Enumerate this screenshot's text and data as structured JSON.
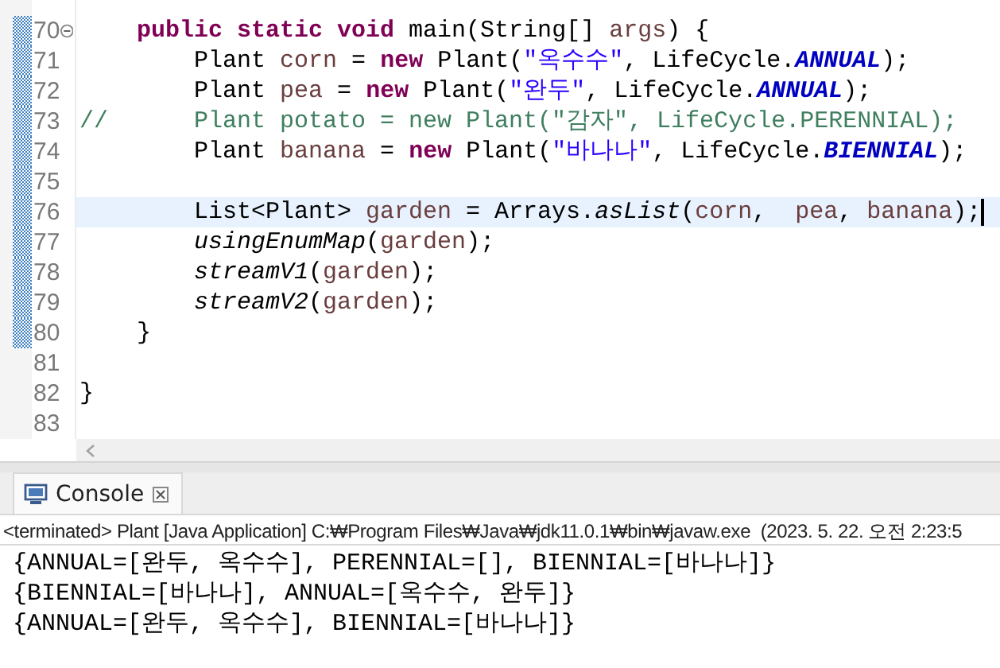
{
  "editor": {
    "lines": [
      {
        "number": "70",
        "marked": true,
        "fold_toggle": true,
        "current": false,
        "tokens": [
          {
            "kind": "keyword",
            "text": "    public"
          },
          {
            "kind": "keyword",
            "text": " static"
          },
          {
            "kind": "keyword",
            "text": " void"
          },
          {
            "kind": "plain",
            "text": " main(String[] "
          },
          {
            "kind": "local",
            "text": "args"
          },
          {
            "kind": "plain",
            "text": ") {"
          }
        ]
      },
      {
        "number": "71",
        "marked": true,
        "fold_toggle": false,
        "current": false,
        "tokens": [
          {
            "kind": "plain",
            "text": "        Plant "
          },
          {
            "kind": "local",
            "text": "corn"
          },
          {
            "kind": "plain",
            "text": " = "
          },
          {
            "kind": "keyword",
            "text": "new"
          },
          {
            "kind": "plain",
            "text": " Plant("
          },
          {
            "kind": "string",
            "text": "\"옥수수\""
          },
          {
            "kind": "plain",
            "text": ", LifeCycle."
          },
          {
            "kind": "field",
            "text": "ANNUAL"
          },
          {
            "kind": "plain",
            "text": ");"
          }
        ]
      },
      {
        "number": "72",
        "marked": true,
        "fold_toggle": false,
        "current": false,
        "tokens": [
          {
            "kind": "plain",
            "text": "        Plant "
          },
          {
            "kind": "local",
            "text": "pea"
          },
          {
            "kind": "plain",
            "text": " = "
          },
          {
            "kind": "keyword",
            "text": "new"
          },
          {
            "kind": "plain",
            "text": " Plant("
          },
          {
            "kind": "string",
            "text": "\"완두\""
          },
          {
            "kind": "plain",
            "text": ", LifeCycle."
          },
          {
            "kind": "field",
            "text": "ANNUAL"
          },
          {
            "kind": "plain",
            "text": ");"
          }
        ]
      },
      {
        "number": "73",
        "marked": true,
        "fold_toggle": false,
        "current": false,
        "tokens": [
          {
            "kind": "comment",
            "text": "//      Plant potato = new Plant(\"감자\", LifeCycle.PERENNIAL);"
          }
        ]
      },
      {
        "number": "74",
        "marked": true,
        "fold_toggle": false,
        "current": false,
        "tokens": [
          {
            "kind": "plain",
            "text": "        Plant "
          },
          {
            "kind": "local",
            "text": "banana"
          },
          {
            "kind": "plain",
            "text": " = "
          },
          {
            "kind": "keyword",
            "text": "new"
          },
          {
            "kind": "plain",
            "text": " Plant("
          },
          {
            "kind": "string",
            "text": "\"바나나\""
          },
          {
            "kind": "plain",
            "text": ", LifeCycle."
          },
          {
            "kind": "field",
            "text": "BIENNIAL"
          },
          {
            "kind": "plain",
            "text": ");"
          }
        ]
      },
      {
        "number": "75",
        "marked": true,
        "fold_toggle": false,
        "current": false
      },
      {
        "number": "76",
        "marked": true,
        "fold_toggle": false,
        "current": true,
        "tokens": [
          {
            "kind": "plain",
            "text": "        List<Plant> "
          },
          {
            "kind": "local",
            "text": "garden"
          },
          {
            "kind": "plain",
            "text": " = Arrays."
          },
          {
            "kind": "method",
            "text": "asList"
          },
          {
            "kind": "plain",
            "text": "("
          },
          {
            "kind": "local",
            "text": "corn"
          },
          {
            "kind": "plain",
            "text": ",  "
          },
          {
            "kind": "local",
            "text": "pea"
          },
          {
            "kind": "plain",
            "text": ", "
          },
          {
            "kind": "local",
            "text": "banana"
          },
          {
            "kind": "plain",
            "text": ");"
          }
        ]
      },
      {
        "number": "77",
        "marked": true,
        "fold_toggle": false,
        "current": false,
        "tokens": [
          {
            "kind": "method",
            "text": "        usingEnumMap"
          },
          {
            "kind": "plain",
            "text": "("
          },
          {
            "kind": "local",
            "text": "garden"
          },
          {
            "kind": "plain",
            "text": ");"
          }
        ]
      },
      {
        "number": "78",
        "marked": true,
        "fold_toggle": false,
        "current": false,
        "tokens": [
          {
            "kind": "method",
            "text": "        streamV1"
          },
          {
            "kind": "plain",
            "text": "("
          },
          {
            "kind": "local",
            "text": "garden"
          },
          {
            "kind": "plain",
            "text": ");"
          }
        ]
      },
      {
        "number": "79",
        "marked": true,
        "fold_toggle": false,
        "current": false,
        "tokens": [
          {
            "kind": "method",
            "text": "        streamV2"
          },
          {
            "kind": "plain",
            "text": "("
          },
          {
            "kind": "local",
            "text": "garden"
          },
          {
            "kind": "plain",
            "text": ");"
          }
        ]
      },
      {
        "number": "80",
        "marked": true,
        "fold_toggle": false,
        "current": false,
        "tokens": [
          {
            "kind": "plain",
            "text": "    }"
          }
        ]
      },
      {
        "number": "81",
        "marked": false,
        "fold_toggle": false,
        "current": false
      },
      {
        "number": "82",
        "marked": false,
        "fold_toggle": false,
        "current": false,
        "tokens": [
          {
            "kind": "plain",
            "text": "}"
          }
        ]
      },
      {
        "number": "83",
        "marked": false,
        "fold_toggle": false,
        "current": false
      }
    ]
  },
  "console": {
    "tabs": [
      {
        "label": "Console",
        "selected": true
      }
    ],
    "status": "<terminated> Plant [Java Application] C:₩Program Files₩Java₩jdk11.0.1₩bin₩javaw.exe  (2023. 5. 22. 오전 2:23:5",
    "output": [
      "{ANNUAL=[완두, 옥수수], PERENNIAL=[], BIENNIAL=[바나나]}",
      "{BIENNIAL=[바나나], ANNUAL=[옥수수, 완두]}",
      "{ANNUAL=[완두, 옥수수], BIENNIAL=[바나나]}"
    ]
  }
}
